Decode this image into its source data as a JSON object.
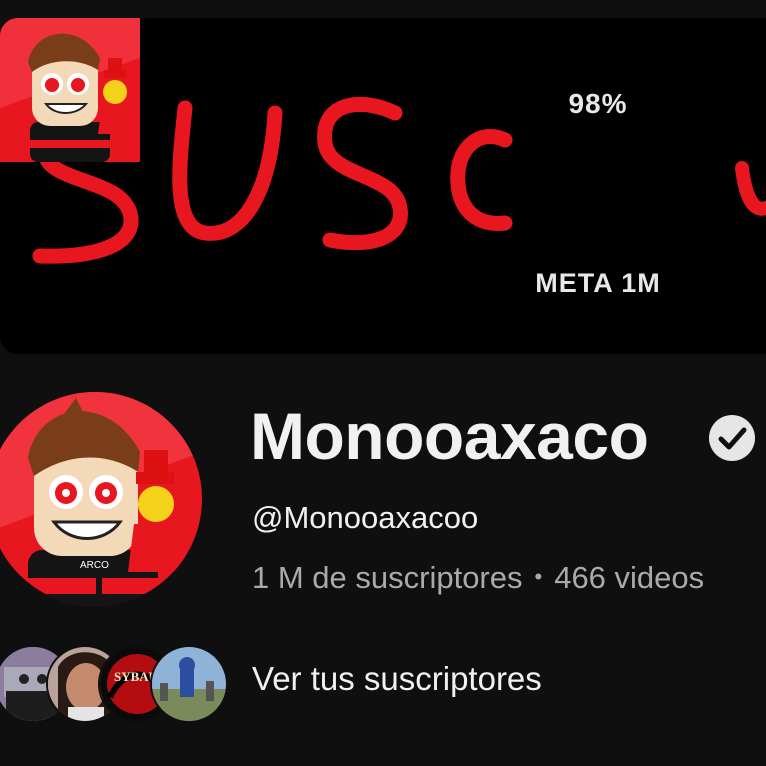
{
  "banner": {
    "scrawl_text": "SUSC",
    "goal_percent": "98%",
    "goal_label": "META 1M"
  },
  "channel": {
    "name": "Monooaxaco",
    "handle": "@Monooaxacoo",
    "subscribers": "1 M de suscriptores",
    "separator": "•",
    "videos": "466 videos",
    "avatar_shirt_text": "ARCO"
  },
  "subscribers_row": {
    "avatar_badge_text": "SYBAU",
    "link_label": "Ver tus suscriptores"
  },
  "colors": {
    "background": "#0f0f0f",
    "banner": "#000000",
    "brand_red": "#e8161e",
    "text_primary": "#f1f1f1",
    "text_secondary": "#aaaaaa"
  }
}
